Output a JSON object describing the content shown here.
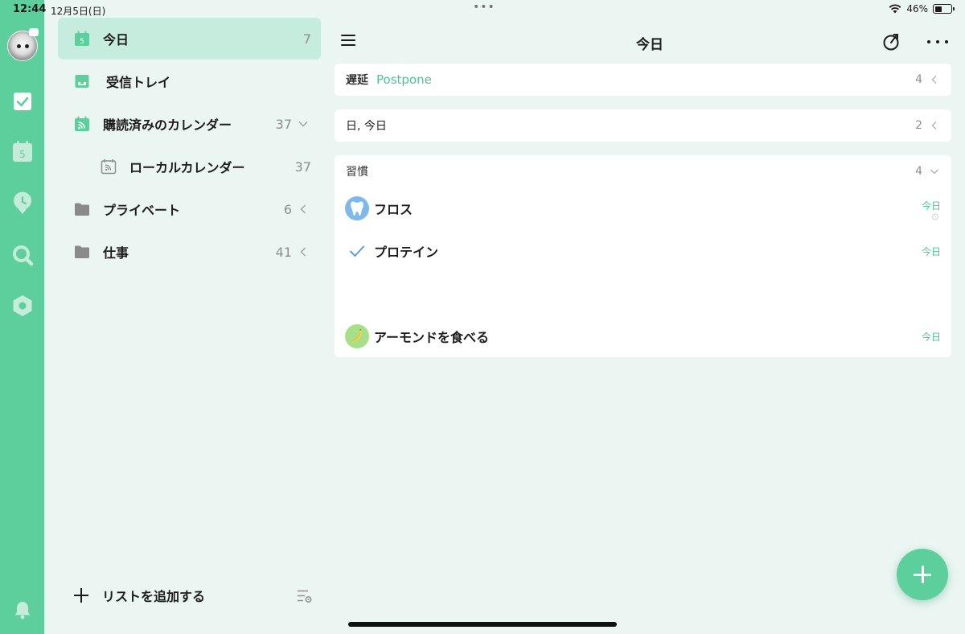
{
  "status": {
    "time": "12:44",
    "date": "12月5日(日)",
    "battery": "46%",
    "battery_level": 0.46
  },
  "rail": {
    "calendar_day": "5",
    "icons": [
      "avatar",
      "checkbox-icon",
      "calendar-icon",
      "clock-icon",
      "search-icon",
      "settings-icon",
      "bell-icon"
    ]
  },
  "sidebar": {
    "items": [
      {
        "label": "今日",
        "count": "7",
        "icon": "calendar-today-icon",
        "badge": "5"
      },
      {
        "label": "受信トレイ",
        "icon": "inbox-icon"
      },
      {
        "label": "購読済みのカレンダー",
        "count": "37",
        "icon": "subscribed-calendar-icon"
      },
      {
        "label": "ローカルカレンダー",
        "count": "37",
        "icon": "local-calendar-icon"
      },
      {
        "label": "プライベート",
        "count": "6",
        "icon": "folder-icon"
      },
      {
        "label": "仕事",
        "count": "41",
        "icon": "folder-icon"
      }
    ],
    "add_list": "リストを追加する"
  },
  "main": {
    "title": "今日",
    "sections": [
      {
        "name": "遅延",
        "accent": "Postpone",
        "count": "4"
      },
      {
        "name": "日, 今日",
        "count": "2"
      },
      {
        "name": "習慣",
        "count": "4"
      }
    ],
    "habits": [
      {
        "title": "フロス",
        "date": "今日",
        "icon": "tooth-icon"
      },
      {
        "title": "プロテイン",
        "date": "今日",
        "icon": "check-icon"
      },
      {
        "title": "アーモンドを食べる",
        "date": "今日",
        "icon": "banana-icon"
      }
    ]
  },
  "colors": {
    "accent": "#5dcf9d",
    "accent_text": "#4dc593",
    "active_bg": "#c6ecde",
    "background": "#ebf5f2"
  }
}
